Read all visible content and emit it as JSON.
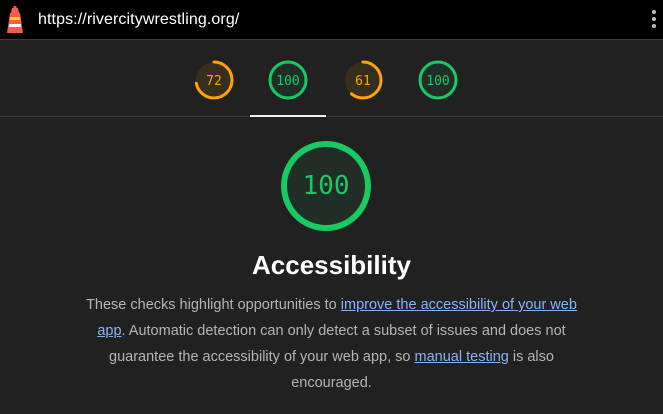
{
  "header": {
    "url": "https://rivercitywrestling.org/",
    "logo_icon": "lighthouse-icon",
    "menu_icon": "kebab-menu-icon"
  },
  "colors": {
    "pass": "#18c964",
    "average": "#ffa400",
    "background": "#212121"
  },
  "gauges": [
    {
      "score": "72",
      "value": 72,
      "status": "average"
    },
    {
      "score": "100",
      "value": 100,
      "status": "pass",
      "selected": true
    },
    {
      "score": "61",
      "value": 61,
      "status": "average"
    },
    {
      "score": "100",
      "value": 100,
      "status": "pass"
    }
  ],
  "category": {
    "score": "100",
    "value": 100,
    "title": "Accessibility",
    "description": {
      "p1": "These checks highlight opportunities to ",
      "link1": "improve the accessibility of your web app",
      "p2": ". Automatic detection can only detect a subset of issues and does not guarantee the accessibility of your web app, so ",
      "link2": "manual testing",
      "p3": " is also encouraged."
    }
  }
}
